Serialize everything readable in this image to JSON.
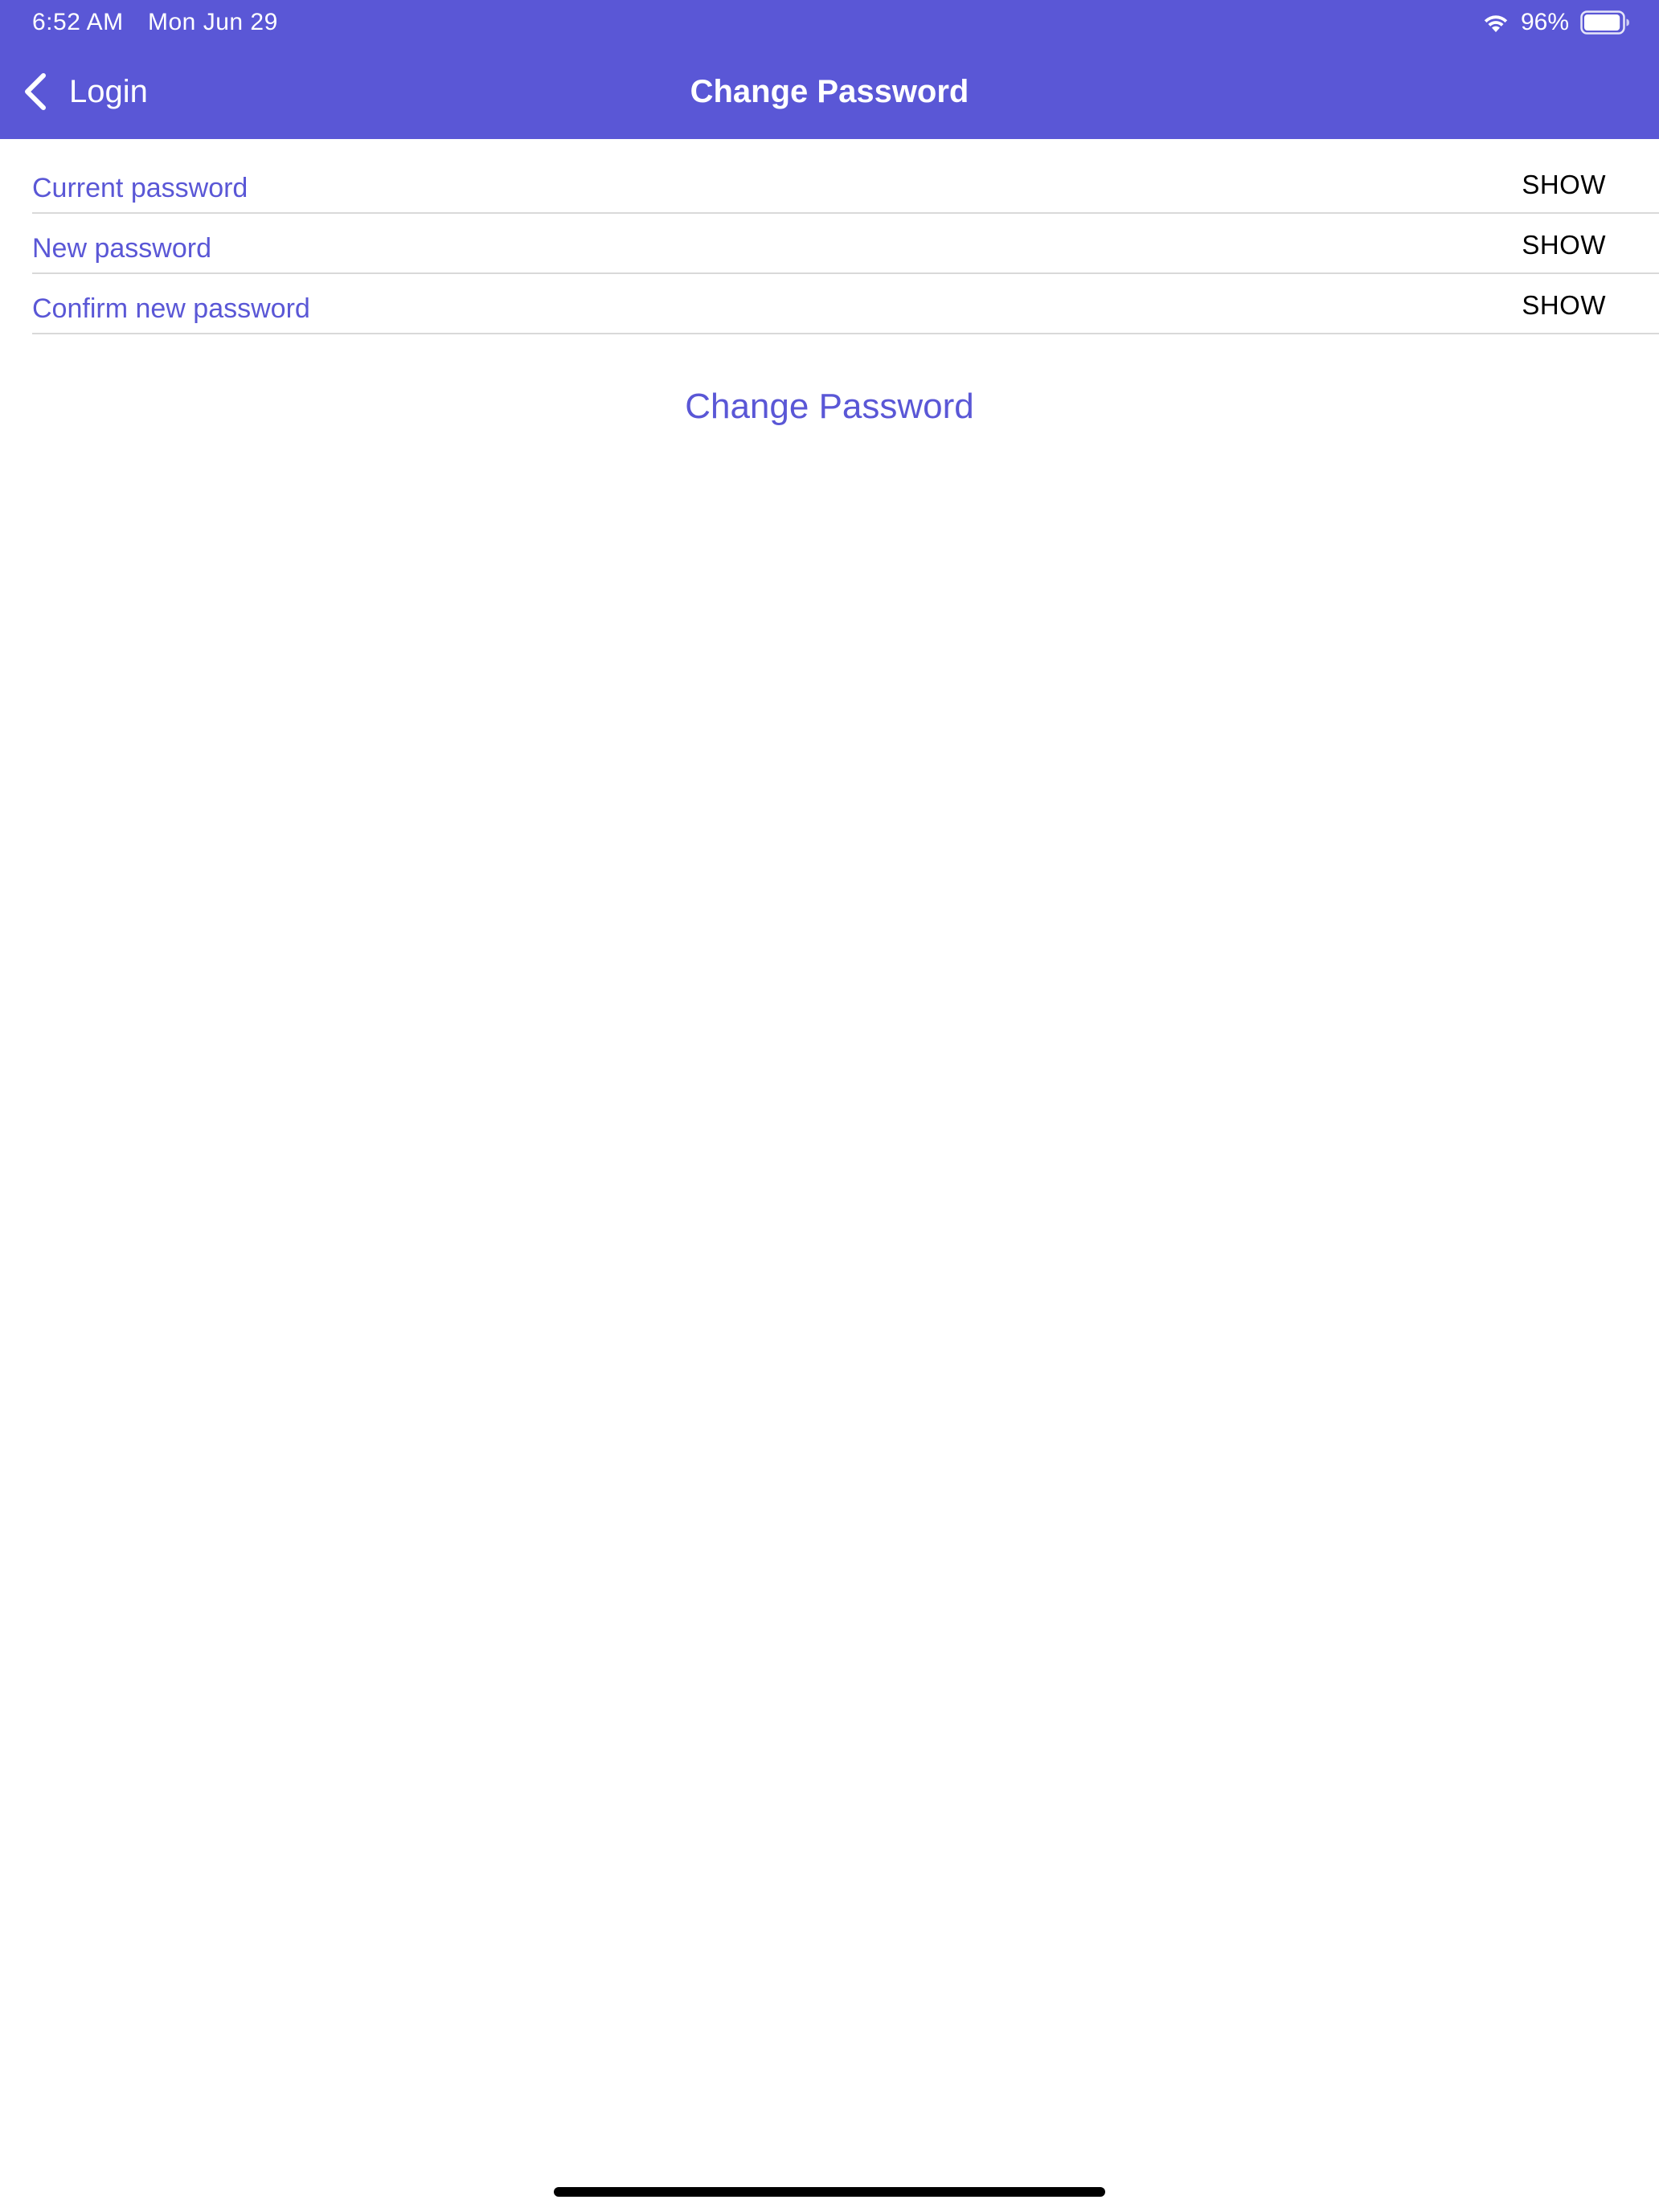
{
  "status_bar": {
    "time": "6:52 AM",
    "date": "Mon Jun 29",
    "battery_percent": "96%",
    "battery_level": 0.96,
    "icons": [
      "wifi-icon",
      "battery-icon"
    ]
  },
  "nav": {
    "back_label": "Login",
    "title": "Change Password",
    "icons": [
      "chevron-left-icon"
    ]
  },
  "form": {
    "fields": [
      {
        "placeholder": "Current password",
        "value": "",
        "toggle_label": "SHOW"
      },
      {
        "placeholder": "New password",
        "value": "",
        "toggle_label": "SHOW"
      },
      {
        "placeholder": "Confirm new password",
        "value": "",
        "toggle_label": "SHOW"
      }
    ],
    "submit_label": "Change Password"
  },
  "colors": {
    "accent": "#5A57D6",
    "header_text": "#FFFFFF",
    "toggle_text": "#000000",
    "divider": "#D9D9D9"
  }
}
